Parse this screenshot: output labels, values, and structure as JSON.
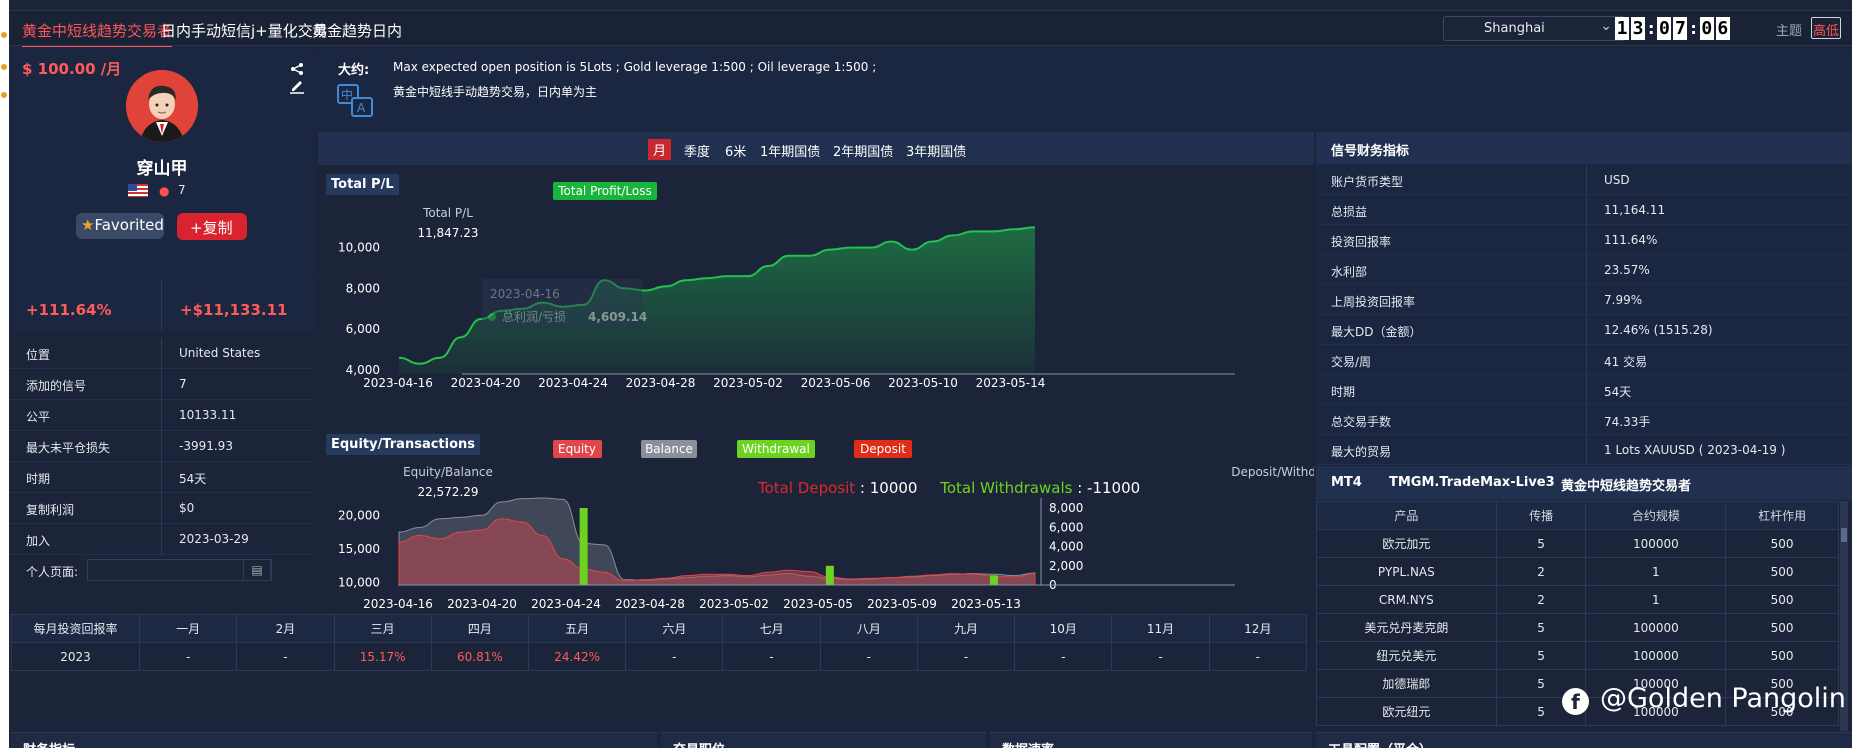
{
  "nav": {
    "tabs": [
      "黄金中短线趋势交易者",
      "日内手动短信j+量化交易",
      "黄金趋势日内"
    ],
    "timezone": "Shanghai",
    "clock": [
      "1",
      "3",
      "0",
      "7",
      "0",
      "6"
    ],
    "theme_label": "主题",
    "theme_value": "高低"
  },
  "profile": {
    "price": "$ 100.00 /月",
    "name": "穿山甲",
    "followers": "7",
    "favorited_label": "Favorited",
    "copy_label": "+复制",
    "return_pct": "+111.64%",
    "profit": "+$11,133.11",
    "info": [
      {
        "k": "位置",
        "v": "United States"
      },
      {
        "k": "添加的信号",
        "v": "7"
      },
      {
        "k": "公平",
        "v": "10133.11"
      },
      {
        "k": "最大未平仓损失",
        "v": "-3991.93"
      },
      {
        "k": "时期",
        "v": "54天"
      },
      {
        "k": "复制利润",
        "v": "$0"
      },
      {
        "k": "加入",
        "v": "2023-03-29"
      }
    ],
    "personal_label": "个人页面:"
  },
  "description": {
    "label": "大约:",
    "line1": "Max expected open position is 5Lots ; Gold leverage 1:500 ; Oil leverage 1:500 ;",
    "line2": "黄金中短线手动趋势交易，日内单为主"
  },
  "period_tabs": [
    "月",
    "季度",
    "6米",
    "1年期国债",
    "2年期国债",
    "3年期国债"
  ],
  "colors": {
    "accent_red": "#ff5b5b",
    "green": "#1fc24a",
    "bg": "#1b2438"
  },
  "chart_data": [
    {
      "type": "area",
      "title": "Total P/L",
      "legend": [
        "Total Profit/Loss"
      ],
      "ylabel": "Total P/L",
      "y_max_label": "11,847.23",
      "y_ticks": [
        "4,000",
        "6,000",
        "8,000",
        "10,000"
      ],
      "x_ticks": [
        "2023-04-16",
        "2023-04-20",
        "2023-04-24",
        "2023-04-28",
        "2023-05-02",
        "2023-05-06",
        "2023-05-10",
        "2023-05-14"
      ],
      "ylim": [
        4000,
        11847.23
      ],
      "tooltip": {
        "date": "2023-04-16",
        "label": "总利润/亏损",
        "value": "4,609.14"
      },
      "series": [
        {
          "name": "Total Profit/Loss",
          "values": [
            4600,
            4300,
            4600,
            5600,
            6500,
            6900,
            7000,
            7300,
            7100,
            7200,
            8400,
            8000,
            7900,
            8100,
            8400,
            8500,
            8600,
            8600,
            9100,
            9600,
            9600,
            9900,
            10000,
            10000,
            10300,
            9900,
            10300,
            10600,
            10800,
            10800,
            10900,
            11000
          ]
        }
      ]
    },
    {
      "type": "area",
      "title": "Equity/Transactions",
      "legend": [
        "Equity",
        "Balance",
        "Withdrawal",
        "Deposit"
      ],
      "ylabel": "Equity/Balance",
      "y2label": "Deposit/Withdrawal",
      "y_max_label": "22,572.29",
      "y_ticks": [
        "10,000",
        "15,000",
        "20,000"
      ],
      "y2_ticks": [
        "0",
        "2,000",
        "4,000",
        "6,000",
        "8,000"
      ],
      "x_ticks": [
        "2023-04-16",
        "2023-04-20",
        "2023-04-24",
        "2023-04-28",
        "2023-05-02",
        "2023-05-05",
        "2023-05-09",
        "2023-05-13"
      ],
      "total_deposit_label": "Total Deposit",
      "total_deposit": "10000",
      "total_withdrawals_label": "Total Withdrawals",
      "total_withdrawals": "-11000",
      "series": [
        {
          "name": "Balance",
          "values": [
            17500,
            18200,
            19500,
            19700,
            20000,
            22000,
            22500,
            22600,
            22400,
            15800,
            15600,
            10400,
            10300,
            10500,
            10700,
            10900,
            11000,
            10800,
            11100,
            11300,
            10900,
            10600,
            10400,
            10500,
            10700,
            10800,
            11000,
            11200,
            11300,
            11200,
            11000,
            11400
          ]
        },
        {
          "name": "Equity",
          "values": [
            16000,
            17000,
            16500,
            17500,
            17800,
            19500,
            19000,
            17000,
            13500,
            12000,
            11500,
            10200,
            10400,
            10600,
            11000,
            11200,
            11200,
            11000,
            11500,
            11800,
            11600,
            10800,
            10500,
            10600,
            10700,
            10900,
            11100,
            11300,
            11200,
            10900,
            10800,
            11300
          ]
        },
        {
          "name": "Withdrawal",
          "values": [
            0,
            0,
            0,
            0,
            0,
            0,
            0,
            0,
            0,
            8000,
            0,
            0,
            0,
            0,
            0,
            0,
            0,
            0,
            0,
            0,
            0,
            2000,
            0,
            0,
            0,
            0,
            0,
            0,
            0,
            1000,
            0,
            0
          ]
        }
      ]
    }
  ],
  "monthly": {
    "header": [
      "每月投资回报率",
      "一月",
      "2月",
      "三月",
      "四月",
      "五月",
      "六月",
      "七月",
      "八月",
      "九月",
      "10月",
      "11月",
      "12月"
    ],
    "row": [
      "2023",
      "-",
      "-",
      "15.17%",
      "60.81%",
      "24.42%",
      "-",
      "-",
      "-",
      "-",
      "-",
      "-",
      "-"
    ]
  },
  "financial": {
    "title": "信号财务指标",
    "rows": [
      {
        "k": "账户货币类型",
        "v": "USD"
      },
      {
        "k": "总损益",
        "v": "11,164.11"
      },
      {
        "k": "投资回报率",
        "v": "111.64%"
      },
      {
        "k": "水利部",
        "v": "23.57%"
      },
      {
        "k": "上周投资回报率",
        "v": "7.99%"
      },
      {
        "k": "最大DD（金额）",
        "v": "12.46%    (1515.28)"
      },
      {
        "k": "交易/周",
        "v": "41 交易"
      },
      {
        "k": "时期",
        "v": "54天"
      },
      {
        "k": "总交易手数",
        "v": "74.33手"
      },
      {
        "k": "最大的贸易",
        "v": "1 Lots XAUUSD ( 2023-04-19 )"
      }
    ]
  },
  "mt4": {
    "platform": "MT4",
    "server": "TMGM.TradeMax-Live3",
    "name": "黄金中短线趋势交易者",
    "columns": [
      "产品",
      "传播",
      "合约规模",
      "杠杆作用"
    ],
    "rows": [
      [
        "欧元加元",
        "5",
        "100000",
        "500"
      ],
      [
        "PYPL.NAS",
        "2",
        "1",
        "500"
      ],
      [
        "CRM.NYS",
        "2",
        "1",
        "500"
      ],
      [
        "美元兑丹麦克朗",
        "5",
        "100000",
        "500"
      ],
      [
        "纽元兑美元",
        "5",
        "100000",
        "500"
      ],
      [
        "加德瑞郎",
        "5",
        "100000",
        "500"
      ],
      [
        "欧元纽元",
        "5",
        "100000",
        "500"
      ]
    ]
  },
  "bottom_panels": [
    "财务指标",
    "交易职位",
    "数据速率",
    "工具配置（平仓）"
  ],
  "watermark": "@Golden Pangolin"
}
